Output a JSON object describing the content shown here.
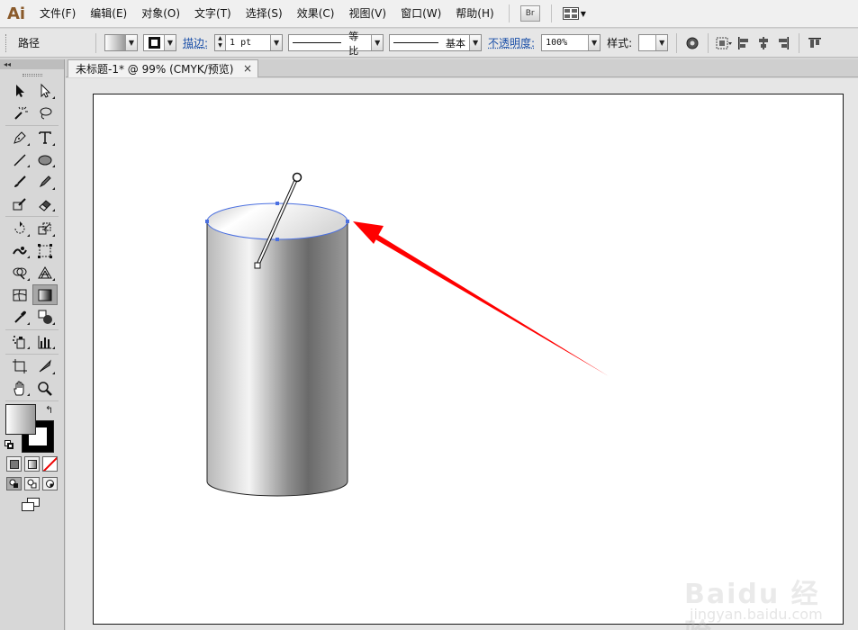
{
  "app": {
    "logo": "Ai"
  },
  "menu": {
    "items": [
      "文件(F)",
      "编辑(E)",
      "对象(O)",
      "文字(T)",
      "选择(S)",
      "效果(C)",
      "视图(V)",
      "窗口(W)",
      "帮助(H)"
    ],
    "bridge_label": "Br"
  },
  "control_bar": {
    "selection_label": "路径",
    "stroke_label": "描边:",
    "stroke_weight": "1 pt",
    "profile_label": "等比",
    "brush_label": "基本",
    "opacity_label": "不透明度:",
    "opacity_value": "100%",
    "style_label": "样式:"
  },
  "document": {
    "tab_title": "未标题-1* @ 99% (CMYK/预览)",
    "close_glyph": "×"
  },
  "tools": {
    "collapse_glyph": "◂◂",
    "items": [
      [
        "selection-tool-icon",
        "direct-selection-tool-icon"
      ],
      [
        "magic-wand-tool-icon",
        "lasso-tool-icon"
      ],
      [
        "pen-tool-icon",
        "type-tool-icon"
      ],
      [
        "line-segment-tool-icon",
        "ellipse-tool-icon"
      ],
      [
        "paintbrush-tool-icon",
        "pencil-tool-icon"
      ],
      [
        "blob-brush-tool-icon",
        "eraser-tool-icon"
      ],
      [
        "rotate-tool-icon",
        "scale-tool-icon"
      ],
      [
        "warp-tool-icon",
        "free-transform-tool-icon"
      ],
      [
        "shape-builder-tool-icon",
        "perspective-grid-tool-icon"
      ],
      [
        "mesh-tool-icon",
        "gradient-tool-icon"
      ],
      [
        "eyedropper-tool-icon",
        "blend-tool-icon"
      ],
      [
        "symbol-sprayer-tool-icon",
        "column-graph-tool-icon"
      ],
      [
        "artboard-tool-icon",
        "slice-tool-icon"
      ],
      [
        "hand-tool-icon",
        "zoom-tool-icon"
      ]
    ],
    "active_tool": "gradient-tool-icon"
  },
  "colors": {
    "arrow": "#ff0000",
    "selection": "#4a6fe0",
    "logo": "#8a5a2b"
  },
  "watermark": {
    "main": "Baidu 经验",
    "sub": "jingyan.baidu.com"
  }
}
